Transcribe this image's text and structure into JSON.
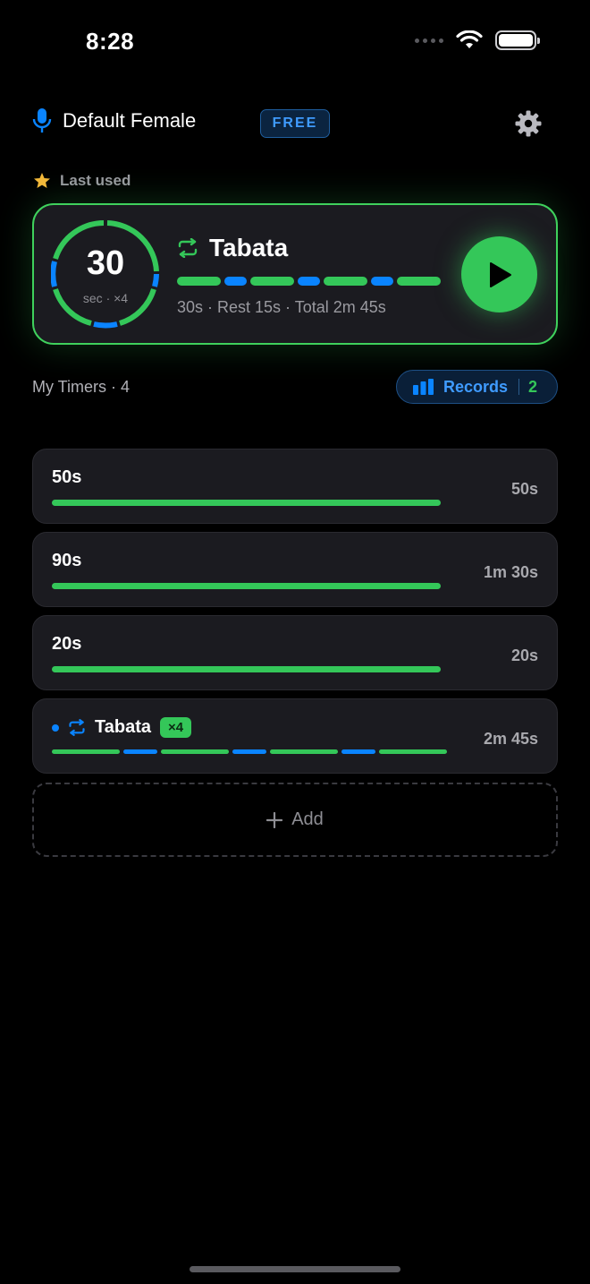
{
  "status_bar": {
    "time": "8:28"
  },
  "header": {
    "voice_label": "Default Female",
    "plan_badge": "FREE"
  },
  "last_used": {
    "label": "Last used",
    "card": {
      "ring_value": "30",
      "ring_sub": "sec · ×4",
      "title": "Tabata",
      "meta": "30s · Rest 15s · Total 2m 45s",
      "segments": [
        "work",
        "rest",
        "work",
        "rest",
        "work",
        "rest",
        "work"
      ]
    }
  },
  "timers_section": {
    "header": "My Timers · 4",
    "records_label": "Records",
    "records_count": "2"
  },
  "timers": [
    {
      "name": "50s",
      "duration": "50s",
      "progress": 1.0
    },
    {
      "name": "90s",
      "duration": "1m 30s",
      "progress": 1.0
    },
    {
      "name": "20s",
      "duration": "20s",
      "progress": 1.0
    },
    {
      "name": "Tabata",
      "badge": "×4",
      "duration": "2m 45s",
      "segments": [
        "work",
        "rest",
        "work",
        "rest",
        "work",
        "rest",
        "work"
      ]
    }
  ],
  "add_button": {
    "label": "Add"
  },
  "colors": {
    "accent_green": "#34c759",
    "accent_blue": "#0a84ff",
    "card_bg": "#1b1b20"
  },
  "icons": [
    "microphone-icon",
    "gear-icon",
    "star-icon",
    "repeat-icon",
    "play-icon",
    "bar-chart-icon",
    "plus-icon"
  ]
}
